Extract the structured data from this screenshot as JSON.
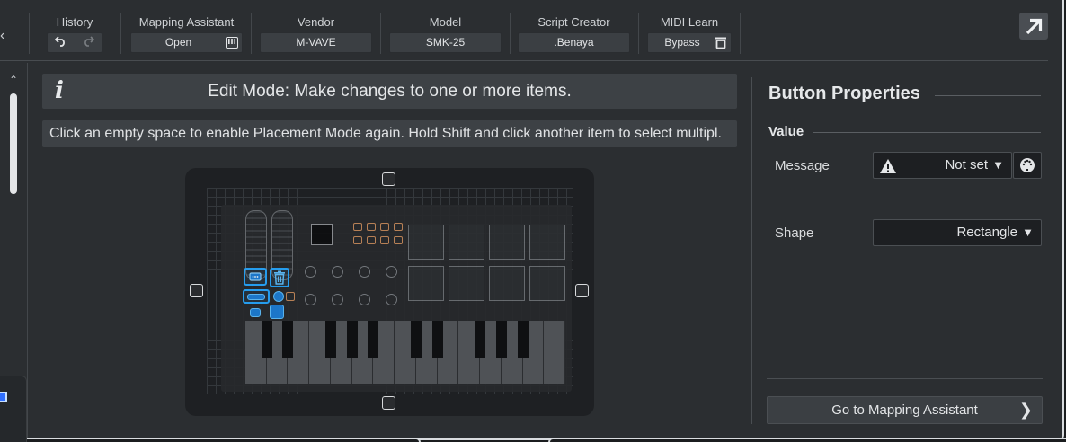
{
  "toolbar": {
    "history": {
      "label": "History",
      "undo_icon": "undo-icon",
      "redo_icon": "redo-icon"
    },
    "mapping_assistant": {
      "label": "Mapping Assistant",
      "value": "Open",
      "icon": "mapping-assistant-icon"
    },
    "vendor": {
      "label": "Vendor",
      "value": "M-VAVE"
    },
    "model": {
      "label": "Model",
      "value": "SMK-25"
    },
    "script_creator": {
      "label": "Script Creator",
      "value": ".Benaya"
    },
    "midi_learn": {
      "label": "MIDI Learn",
      "value": "Bypass",
      "icon": "bypass-icon"
    },
    "expand_icon": "expand-arrow-icon"
  },
  "banners": {
    "edit_mode": "Edit Mode: Make changes to one or more items.",
    "info_icon": "i",
    "hint": "Click an empty space to enable Placement Mode again. Hold Shift and click another item to select multipl."
  },
  "properties": {
    "title": "Button Properties",
    "value_section": "Value",
    "message_label": "Message",
    "message_value": "Not set",
    "shape_label": "Shape",
    "shape_value": "Rectangle",
    "goto_button": "Go to Mapping Assistant"
  },
  "colors": {
    "accent": "#26a7ff",
    "pad_outline": "#c5895a",
    "warning": "#e6e8ea"
  }
}
